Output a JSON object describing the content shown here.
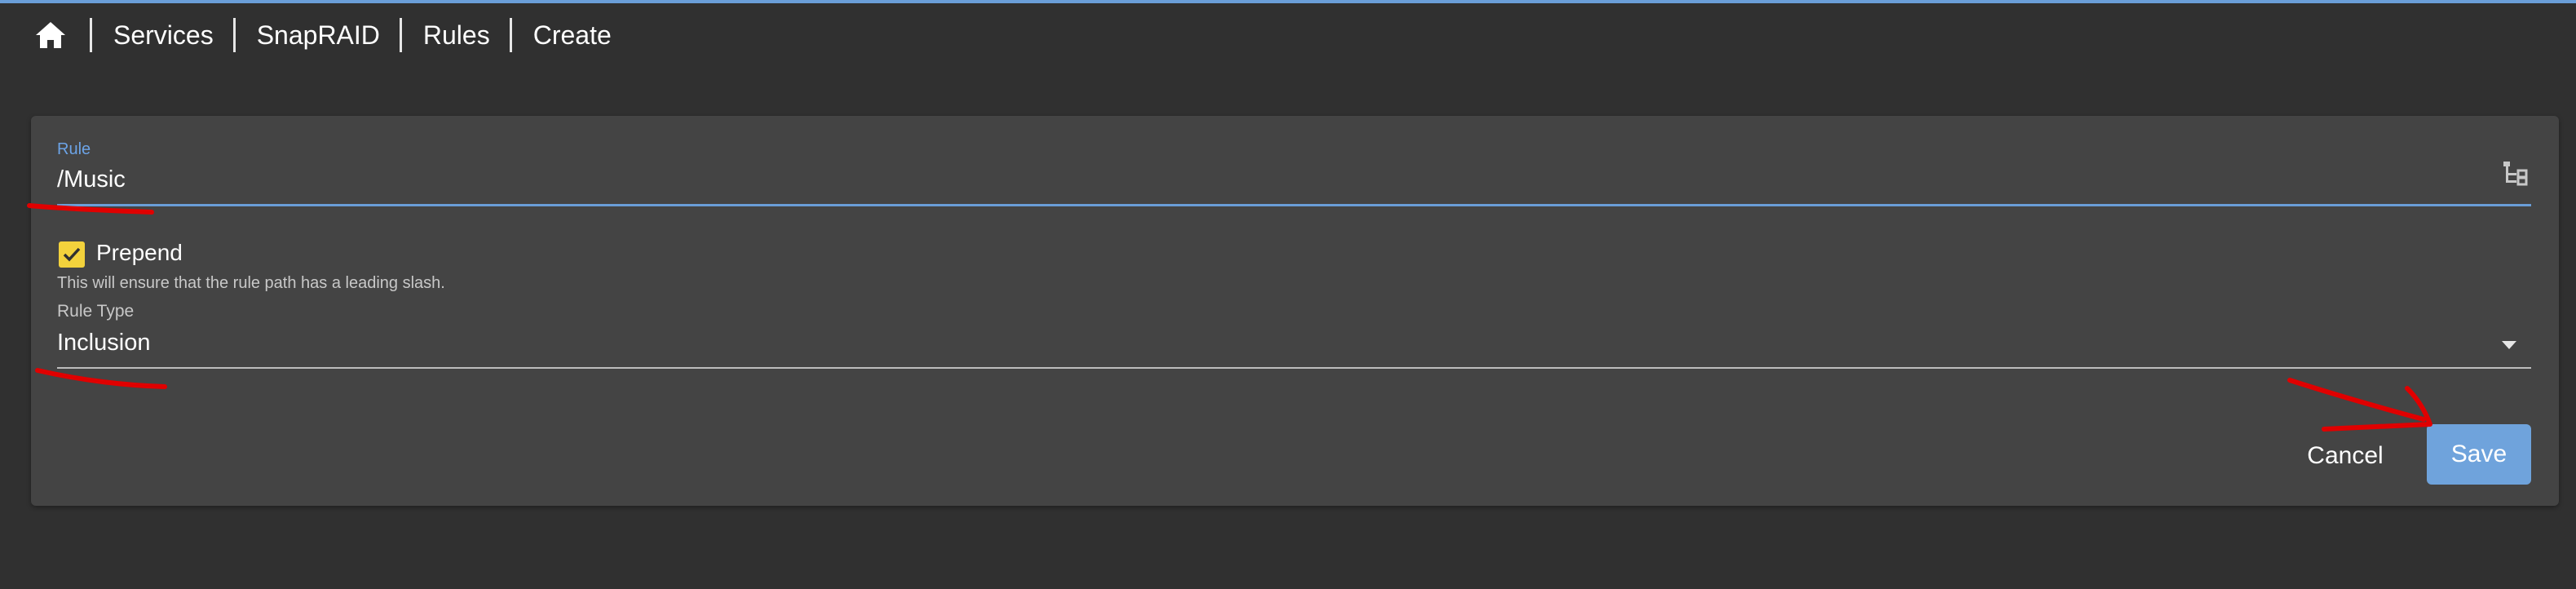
{
  "breadcrumb": {
    "home_icon": "home-icon",
    "items": [
      "Services",
      "SnapRAID",
      "Rules",
      "Create"
    ]
  },
  "form": {
    "rule": {
      "label": "Rule",
      "value": "/Music",
      "icon": "folder-tree-icon"
    },
    "prepend": {
      "label": "Prepend",
      "checked": true,
      "hint": "This will ensure that the rule path has a leading slash."
    },
    "rule_type": {
      "label": "Rule Type",
      "value": "Inclusion"
    }
  },
  "actions": {
    "cancel_label": "Cancel",
    "save_label": "Save"
  },
  "colors": {
    "background": "#303030",
    "card": "#444444",
    "accent": "#6a9ed8",
    "checkbox": "#f3d23c",
    "annotation": "#e00000"
  }
}
